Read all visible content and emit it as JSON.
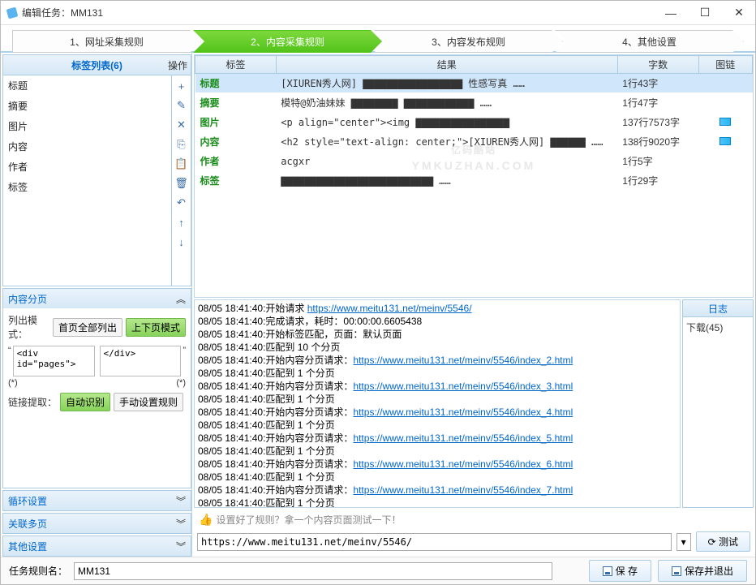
{
  "window": {
    "title": "编辑任务：MM131"
  },
  "wizard": {
    "tab1": "1、网址采集规则",
    "tab2": "2、内容采集规则",
    "tab3": "3、内容发布规则",
    "tab4": "4、其他设置"
  },
  "tagPanel": {
    "header": "标签列表(6)",
    "ops": "操作",
    "items": [
      "标题",
      "摘要",
      "图片",
      "内容",
      "作者",
      "标签"
    ]
  },
  "sideToolbar": {
    "add": "+",
    "edit": "✎",
    "delete": "✕",
    "copy": "⎘",
    "paste": "📋",
    "trash": "🗑",
    "undo": "↶",
    "up": "↑",
    "down": "↓"
  },
  "paging": {
    "header": "内容分页",
    "listModeLabel": "列出模式：",
    "btnFirstAll": "首页全部列出",
    "btnPrevNext": "上下页模式",
    "startQuote": "“",
    "endQuote": "”",
    "startText": "<div id=\"pages\">",
    "endText": "</div>",
    "starL": "(*)",
    "starR": "(*)",
    "linkExtractLabel": "链接提取：",
    "btnAuto": "自动识别",
    "btnManual": "手动设置规则"
  },
  "acc2": {
    "header": "循环设置"
  },
  "acc3": {
    "header": "关联多页"
  },
  "acc4": {
    "header": "其他设置"
  },
  "resultTable": {
    "headers": {
      "tag": "标签",
      "result": "结果",
      "count": "字数",
      "img": "图链"
    },
    "rows": [
      {
        "tag": "标题",
        "result": "[XIUREN秀人网] ▇▇▇▇▇▇▇▇▇▇▇▇▇▇▇▇▇ 性感写真 ……",
        "count": "1行43字",
        "img": false,
        "selected": true
      },
      {
        "tag": "摘要",
        "result": "模特@奶油妹妹 ▇▇▇▇▇▇▇▇ ▇▇▇▇▇▇▇▇▇▇▇▇ ……",
        "count": "1行47字",
        "img": false
      },
      {
        "tag": "图片",
        "result": "<p align=\"center\"><img ▇▇▇▇▇▇▇▇▇▇▇▇▇▇▇▇",
        "count": "137行7573字",
        "img": true
      },
      {
        "tag": "内容",
        "result": "<h2 style=\"text-align: center;\">[XIUREN秀人网] ▇▇▇▇▇▇ ……",
        "count": "138行9020字",
        "img": true
      },
      {
        "tag": "作者",
        "result": "acgxr",
        "count": "1行5字",
        "img": false
      },
      {
        "tag": "标签",
        "result": "▇▇▇▇▇▇▇▇▇▇▇▇▇▇▇▇▇▇▇▇▇▇▇▇▇▇ ……",
        "count": "1行29字",
        "img": false
      }
    ]
  },
  "watermark": {
    "main": "亿码酷站",
    "sub": "YMKUZHAN.COM"
  },
  "log": {
    "sideHeader": "日志",
    "sideDownload": "下载(45)",
    "lines": [
      {
        "t": "08/05 18:41:40:开始请求 ",
        "url": "https://www.meitu131.net/meinv/5546/"
      },
      {
        "t": "08/05 18:41:40:完成请求，耗时：00:00:00.6605438"
      },
      {
        "t": "08/05 18:41:40:开始标签匹配，页面：默认页面"
      },
      {
        "t": "08/05 18:41:40:匹配到 10 个分页"
      },
      {
        "t": "08/05 18:41:40:开始内容分页请求：",
        "url": "https://www.meitu131.net/meinv/5546/index_2.html"
      },
      {
        "t": "08/05 18:41:40:匹配到 1 个分页"
      },
      {
        "t": "08/05 18:41:40:开始内容分页请求：",
        "url": "https://www.meitu131.net/meinv/5546/index_3.html"
      },
      {
        "t": "08/05 18:41:40:匹配到 1 个分页"
      },
      {
        "t": "08/05 18:41:40:开始内容分页请求：",
        "url": "https://www.meitu131.net/meinv/5546/index_4.html"
      },
      {
        "t": "08/05 18:41:40:匹配到 1 个分页"
      },
      {
        "t": "08/05 18:41:40:开始内容分页请求：",
        "url": "https://www.meitu131.net/meinv/5546/index_5.html"
      },
      {
        "t": "08/05 18:41:40:匹配到 1 个分页"
      },
      {
        "t": "08/05 18:41:40:开始内容分页请求：",
        "url": "https://www.meitu131.net/meinv/5546/index_6.html"
      },
      {
        "t": "08/05 18:41:40:匹配到 1 个分页"
      },
      {
        "t": "08/05 18:41:40:开始内容分页请求：",
        "url": "https://www.meitu131.net/meinv/5546/index_7.html"
      },
      {
        "t": "08/05 18:41:40:匹配到 1 个分页"
      }
    ]
  },
  "urlBar": {
    "hint": "设置好了规则？拿一个内容页面测试一下！",
    "value": "https://www.meitu131.net/meinv/5546/",
    "testBtn": "测试"
  },
  "bottom": {
    "nameLabel": "任务规则名：",
    "nameValue": "MM131",
    "save": "保 存",
    "saveExit": "保存并退出"
  }
}
